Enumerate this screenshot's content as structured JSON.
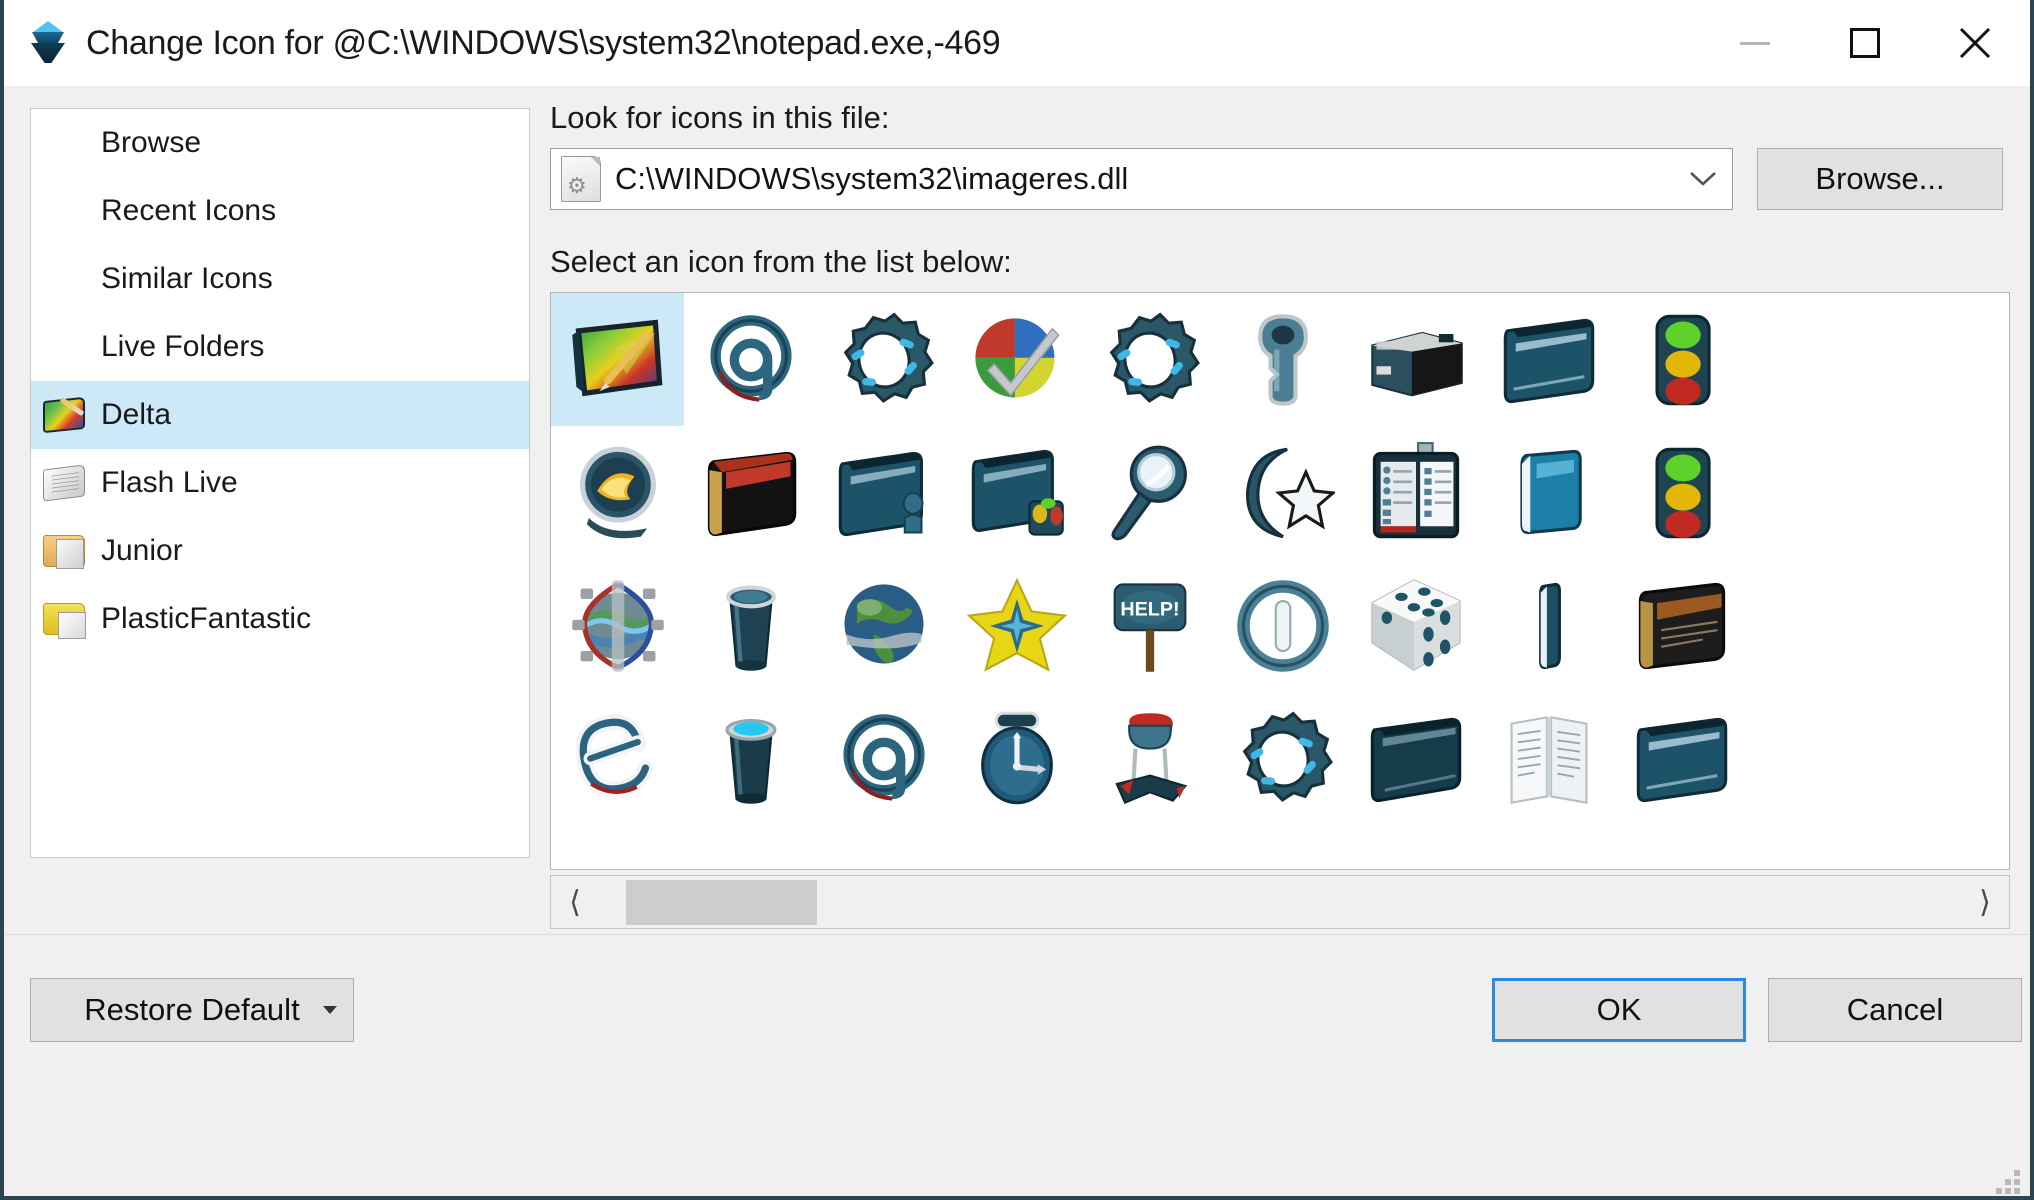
{
  "window": {
    "title": "Change Icon for @C:\\WINDOWS\\system32\\notepad.exe,-469",
    "title_icon": "stacked-cube-icon",
    "accent_color": "#2a8ae0",
    "selection_color": "#cde8f7",
    "border_color": "#2b4450",
    "controls": {
      "minimize": "minimize-icon",
      "maximize": "maximize-icon",
      "close": "close-icon"
    }
  },
  "sidebar": {
    "items": [
      {
        "label": "Browse",
        "icon": "",
        "selected": false
      },
      {
        "label": "Recent Icons",
        "icon": "",
        "selected": false
      },
      {
        "label": "Similar Icons",
        "icon": "",
        "selected": false
      },
      {
        "label": "Live Folders",
        "icon": "",
        "selected": false
      },
      {
        "label": "Delta",
        "icon": "delta-folder-icon",
        "selected": true
      },
      {
        "label": "Flash Live",
        "icon": "paper-stack-icon",
        "selected": false
      },
      {
        "label": "Junior",
        "icon": "manila-folder-icon",
        "selected": false
      },
      {
        "label": "PlasticFantastic",
        "icon": "yellow-folder-icon",
        "selected": false
      }
    ]
  },
  "main": {
    "look_label": "Look for icons in this file:",
    "path_value": "C:\\WINDOWS\\system32\\imageres.dll",
    "path_icon": "dll-file-icon",
    "path_dropdown_icon": "chevron-down-icon",
    "browse_label": "Browse...",
    "select_label": "Select an icon from the list below:",
    "scrollbar": {
      "left_arrow": "chevron-left-icon",
      "right_arrow": "chevron-right-icon",
      "thumb_position_percent": 2,
      "thumb_width_percent": 14
    }
  },
  "icon_grid": {
    "columns": 9,
    "rows": 4,
    "selected_index": 0,
    "icons": [
      {
        "name": "paint-editor-icon",
        "glyph": "paint"
      },
      {
        "name": "at-symbol-icon",
        "glyph": "at"
      },
      {
        "name": "gear-icon",
        "glyph": "gear"
      },
      {
        "name": "pie-chart-check-icon",
        "glyph": "piecheck"
      },
      {
        "name": "gear-icon",
        "glyph": "gear"
      },
      {
        "name": "key-icon",
        "glyph": "key"
      },
      {
        "name": "printer-icon",
        "glyph": "printer"
      },
      {
        "name": "blue-folder-icon",
        "glyph": "bluefolder"
      },
      {
        "name": "traffic-light-icon",
        "glyph": "traffic"
      },
      {
        "name": "crystal-ball-icon",
        "glyph": "crystal"
      },
      {
        "name": "red-book-folder-icon",
        "glyph": "redbook"
      },
      {
        "name": "user-folder-icon",
        "glyph": "userfolder"
      },
      {
        "name": "media-folder-icon",
        "glyph": "mediafolder"
      },
      {
        "name": "magnifier-icon",
        "glyph": "magnifier"
      },
      {
        "name": "moon-star-icon",
        "glyph": "moonstar"
      },
      {
        "name": "start-menu-icon",
        "glyph": "startmenu"
      },
      {
        "name": "blue-panel-icon",
        "glyph": "bluepanel"
      },
      {
        "name": "traffic-light-icon",
        "glyph": "traffic"
      },
      {
        "name": "gear-globe-icon",
        "glyph": "gearglobe"
      },
      {
        "name": "recycle-bin-icon",
        "glyph": "bin"
      },
      {
        "name": "globe-icon",
        "glyph": "globe"
      },
      {
        "name": "yellow-star-icon",
        "glyph": "star"
      },
      {
        "name": "help-sign-icon",
        "glyph": "help"
      },
      {
        "name": "power-button-icon",
        "glyph": "power"
      },
      {
        "name": "dice-icon",
        "glyph": "dice"
      },
      {
        "name": "thin-panel-icon",
        "glyph": "thinpanel"
      },
      {
        "name": "book-icon",
        "glyph": "book"
      },
      {
        "name": "internet-explorer-icon",
        "glyph": "ie"
      },
      {
        "name": "recycle-bin-full-icon",
        "glyph": "binfull"
      },
      {
        "name": "at-symbol-icon",
        "glyph": "at"
      },
      {
        "name": "clock-icon",
        "glyph": "clock"
      },
      {
        "name": "chair-icon",
        "glyph": "chair"
      },
      {
        "name": "gear-icon",
        "glyph": "gear"
      },
      {
        "name": "dark-folder-icon",
        "glyph": "darkfolder"
      },
      {
        "name": "open-book-icon",
        "glyph": "openbook"
      },
      {
        "name": "blue-folder-icon",
        "glyph": "bluefolder"
      }
    ]
  },
  "footer": {
    "restore_label": "Restore Default",
    "restore_dropdown_icon": "caret-down-icon",
    "ok_label": "OK",
    "cancel_label": "Cancel",
    "resize_grip_icon": "resize-grip-icon"
  }
}
